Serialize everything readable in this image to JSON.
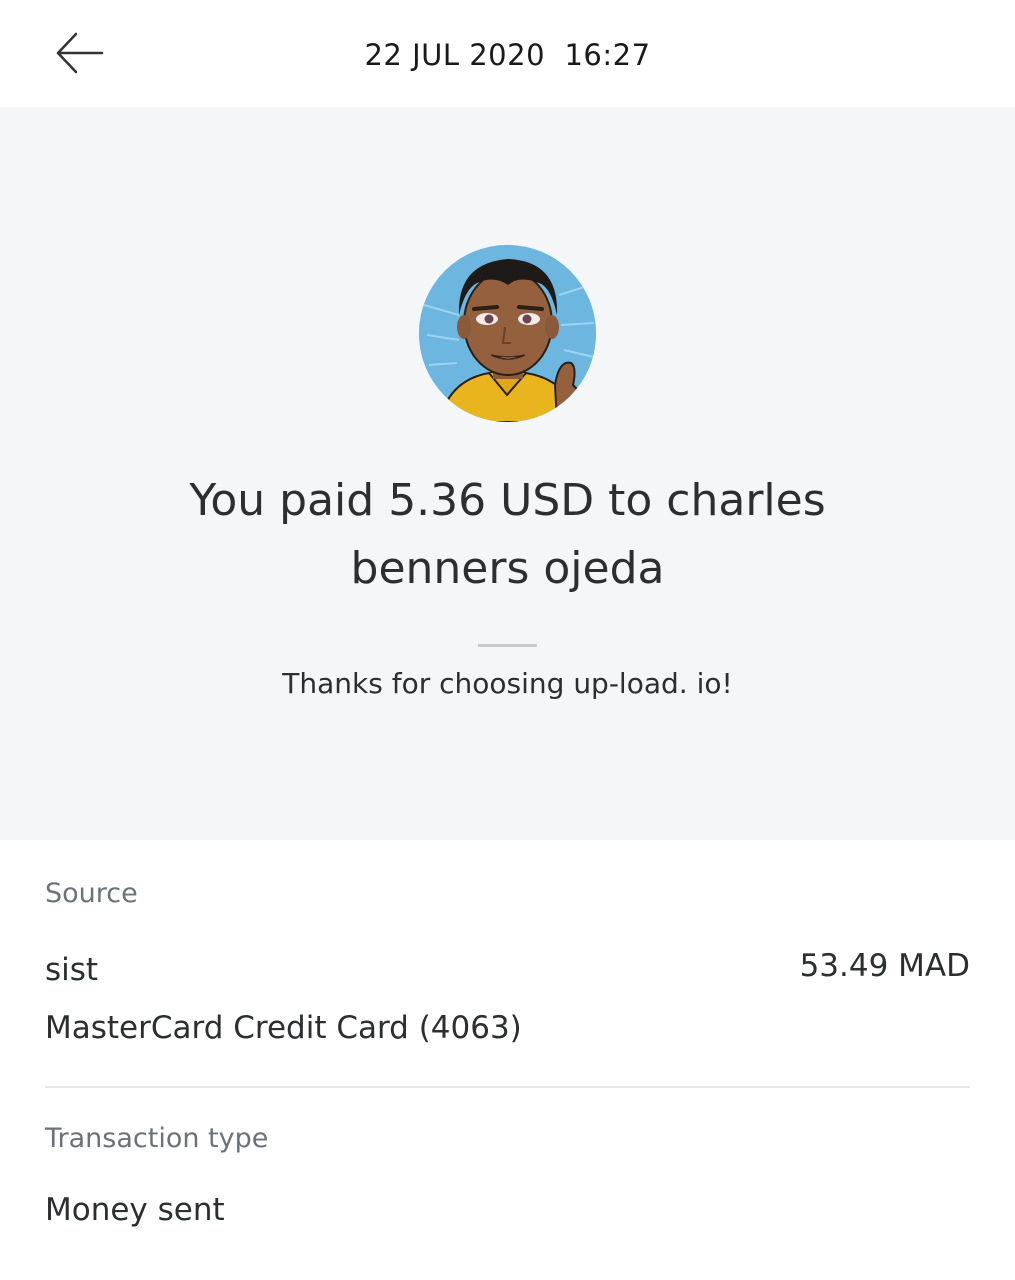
{
  "header": {
    "back_icon": "arrow-left-icon",
    "datetime": "22 JUL 2020  16:27"
  },
  "summary": {
    "avatar": "cartoon-avatar-man-thumbs-up",
    "headline": "You paid 5.36 USD to charles benners ojeda",
    "message": "Thanks for choosing up-load. io!"
  },
  "details": {
    "source": {
      "label": "Source",
      "name": "sist",
      "amount": "53.49 MAD",
      "card": "MasterCard Credit Card (4063)"
    },
    "transaction_type": {
      "label": "Transaction type",
      "value": "Money sent"
    }
  },
  "colors": {
    "hero_background": "#f5f6f8",
    "text_primary": "#2c2e2f",
    "text_secondary": "#6c7378",
    "divider": "#e6e7e8"
  }
}
